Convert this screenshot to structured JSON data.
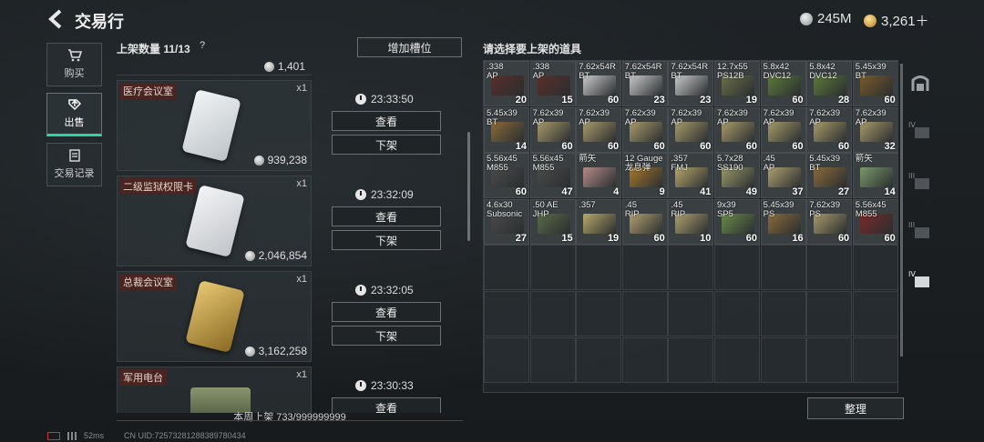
{
  "header": {
    "title": "交易行",
    "currency": [
      {
        "icon": "silver-coin-icon",
        "value": "245M"
      },
      {
        "icon": "gold-coin-icon",
        "value": "3,261＋"
      }
    ]
  },
  "nav": [
    {
      "label": "购买",
      "icon": "cart-icon"
    },
    {
      "label": "出售",
      "icon": "sell-icon",
      "active": true
    },
    {
      "label": "交易记录",
      "icon": "records-icon"
    }
  ],
  "listing": {
    "count_label": "上架数量 11/13",
    "help": "?",
    "add_slot": "增加槽位",
    "top_price": "1,401",
    "entries": [
      {
        "name": "医疗会议室",
        "qty": "x1",
        "price": "939,238",
        "time": "23:33:50",
        "view": "查看",
        "remove": "下架",
        "color": "#cfd5d8"
      },
      {
        "name": "二级监狱权限卡",
        "qty": "x1",
        "price": "2,046,854",
        "time": "23:32:09",
        "view": "查看",
        "remove": "下架",
        "color": "#d8dadc"
      },
      {
        "name": "总裁会议室",
        "qty": "x1",
        "price": "3,162,258",
        "time": "23:32:05",
        "view": "查看",
        "remove": "下架",
        "color": "#c7a34a"
      },
      {
        "name": "军用电台",
        "qty": "x1",
        "price": "",
        "time": "23:30:33",
        "view": "查看",
        "remove": "",
        "color": "#6f7a5c"
      }
    ],
    "weekly": "本周上架 733/999999999"
  },
  "inventory": {
    "title": "请选择要上架的道具",
    "items": [
      {
        "label": ".338\nAP",
        "count": "20",
        "color": "#5a2e2a"
      },
      {
        "label": ".338\nAP",
        "count": "15",
        "color": "#5a2e2a"
      },
      {
        "label": "7.62x54R\nBT",
        "count": "60",
        "color": "#c9c9c9"
      },
      {
        "label": "7.62x54R\nBT",
        "count": "23",
        "color": "#c9c9c9"
      },
      {
        "label": "7.62x54R\nBT",
        "count": "23",
        "color": "#c9c9c9"
      },
      {
        "label": "12.7x55\nPS12B",
        "count": "19",
        "color": "#6b6f4a"
      },
      {
        "label": "5.8x42\nDVC12",
        "count": "60",
        "color": "#5d7a3a"
      },
      {
        "label": "5.8x42\nDVC12",
        "count": "28",
        "color": "#5d7a3a"
      },
      {
        "label": "5.45x39\nBT",
        "count": "60",
        "color": "#7a5a2a"
      },
      {
        "label": "5.45x39\nBT",
        "count": "14",
        "color": "#8a6a3a"
      },
      {
        "label": "7.62x39\nAP",
        "count": "60",
        "color": "#a89a6a"
      },
      {
        "label": "7.62x39\nAP",
        "count": "60",
        "color": "#a89a6a"
      },
      {
        "label": "7.62x39\nAP",
        "count": "60",
        "color": "#a89a6a"
      },
      {
        "label": "7.62x39\nAP",
        "count": "60",
        "color": "#a89a6a"
      },
      {
        "label": "7.62x39\nAP",
        "count": "60",
        "color": "#a89a6a"
      },
      {
        "label": "7.62x39\nAP",
        "count": "60",
        "color": "#a89a6a"
      },
      {
        "label": "7.62x39\nAP",
        "count": "60",
        "color": "#a89a6a"
      },
      {
        "label": "7.62x39\nAP",
        "count": "32",
        "color": "#a89a6a"
      },
      {
        "label": "5.56x45\nM855",
        "count": "60",
        "color": "#4a4a4a"
      },
      {
        "label": "5.56x45\nM855",
        "count": "47",
        "color": "#4a4a4a"
      },
      {
        "label": "箭矢\n",
        "count": "4",
        "color": "#b58a88"
      },
      {
        "label": "12 Gauge\n龙息弹",
        "count": "9",
        "color": "#a8782a"
      },
      {
        "label": ".357\nFMJ",
        "count": "41",
        "color": "#b8a86a"
      },
      {
        "label": "5.7x28\nSS190",
        "count": "49",
        "color": "#9a9a6a"
      },
      {
        "label": ".45\nAP",
        "count": "37",
        "color": "#b0a070"
      },
      {
        "label": "5.45x39\nBT",
        "count": "27",
        "color": "#8a6a3a"
      },
      {
        "label": "箭矢\n",
        "count": "14",
        "color": "#7a9a6a"
      },
      {
        "label": "4.6x30\nSubsonic",
        "count": "27",
        "color": "#4a4a4a"
      },
      {
        "label": ".50 AE\nJHP",
        "count": "15",
        "color": "#5a6a4a"
      },
      {
        "label": ".357\n",
        "count": "19",
        "color": "#b8a86a"
      },
      {
        "label": ".45\nRIP",
        "count": "60",
        "color": "#b0a070"
      },
      {
        "label": ".45\nRIP",
        "count": "10",
        "color": "#b0a070"
      },
      {
        "label": "9x39\nSP5",
        "count": "60",
        "color": "#6a8a4a"
      },
      {
        "label": "5.45x39\nPS",
        "count": "16",
        "color": "#8a6a3a"
      },
      {
        "label": "7.62x39\nPS",
        "count": "60",
        "color": "#a89a6a"
      },
      {
        "label": "5.56x45\nM855",
        "count": "60",
        "color": "#7a2a2a"
      }
    ],
    "sort": "整理",
    "filters": [
      {
        "icon": "all-filter-icon",
        "label": ""
      },
      {
        "icon": "level-iv-filter-icon",
        "label": "IV"
      },
      {
        "icon": "level-iii-filter-icon",
        "label": "III"
      },
      {
        "icon": "level-iii-filter-icon",
        "label": "III"
      },
      {
        "icon": "level-iv-active-filter-icon",
        "label": "IV"
      }
    ]
  },
  "footer": {
    "ping": "52ms",
    "uid": "CN UID:7257328128838978043​4"
  }
}
